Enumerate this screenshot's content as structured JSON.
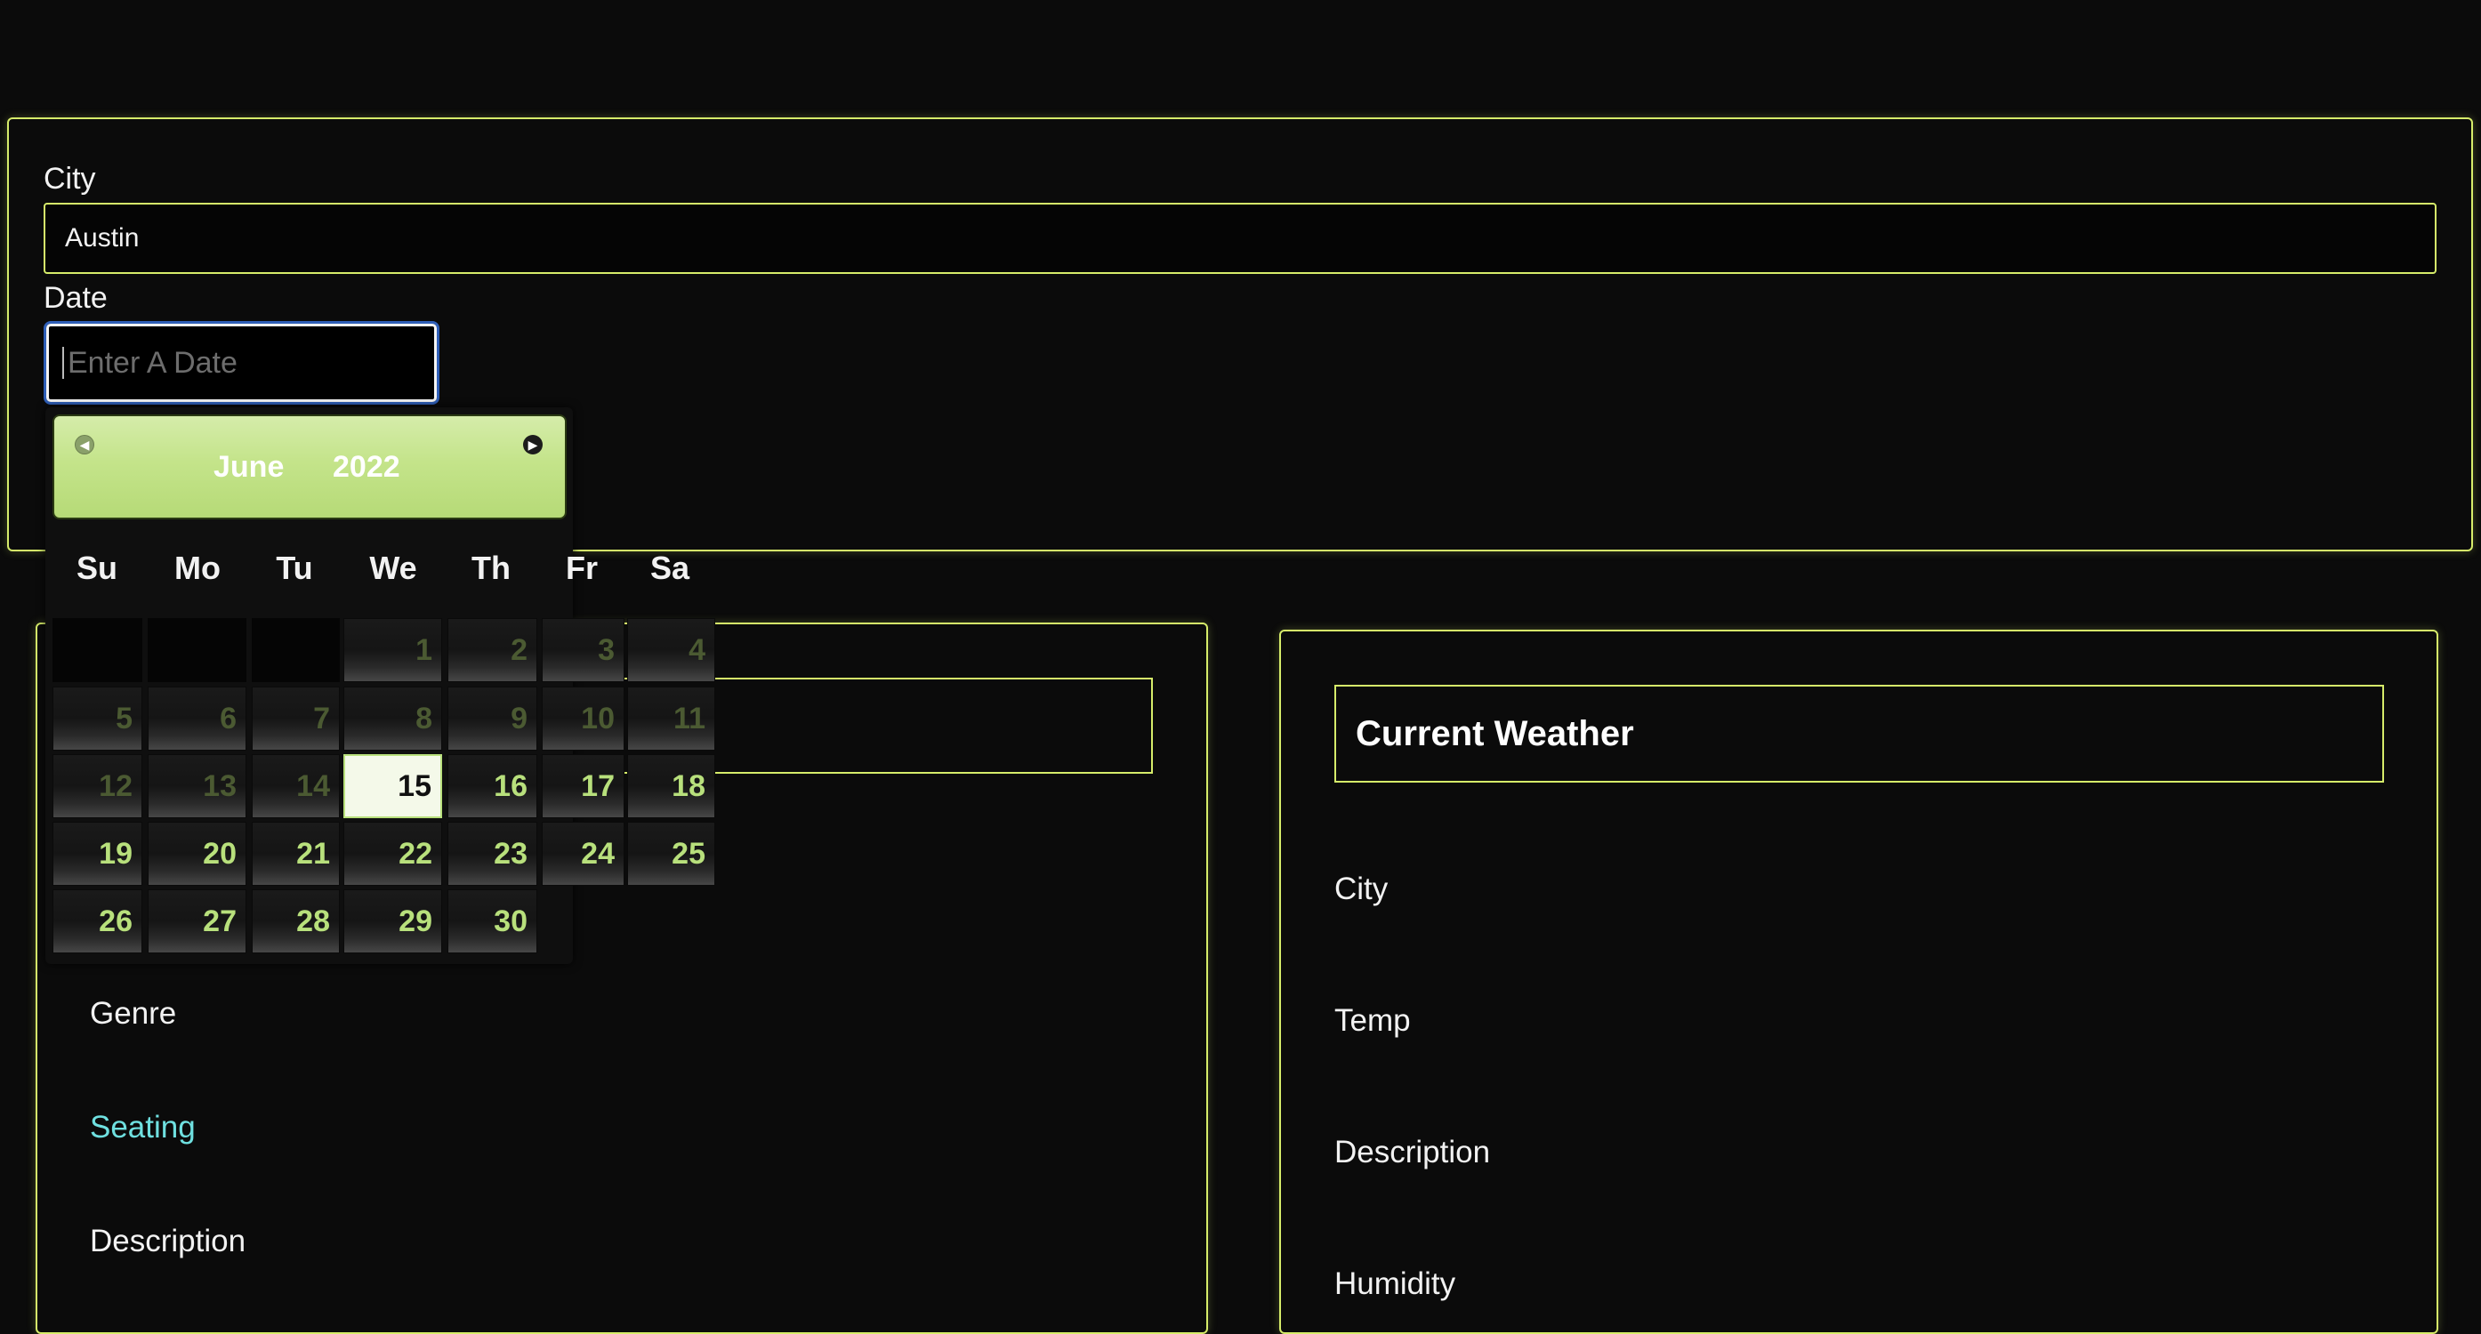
{
  "search": {
    "city_label": "City",
    "city_value": "Austin",
    "date_label": "Date",
    "date_placeholder": "Enter A Date"
  },
  "datepicker": {
    "month": "June",
    "year": "2022",
    "weekdays": [
      "Su",
      "Mo",
      "Tu",
      "We",
      "Th",
      "Fr",
      "Sa"
    ],
    "days": [
      "1",
      "2",
      "3",
      "4",
      "5",
      "6",
      "7",
      "8",
      "9",
      "10",
      "11",
      "12",
      "13",
      "14",
      "15",
      "16",
      "17",
      "18",
      "19",
      "20",
      "21",
      "22",
      "23",
      "24",
      "25",
      "26",
      "27",
      "28",
      "29",
      "30"
    ],
    "selected_day": "15",
    "prev_icon": "prev-arrow-icon",
    "next_icon": "next-arrow-icon"
  },
  "event_panel": {
    "fields": [
      "Genre",
      "Seating",
      "Description"
    ]
  },
  "weather": {
    "title": "Current Weather",
    "fields": [
      "City",
      "Temp",
      "Description",
      "Humidity"
    ]
  },
  "colors": {
    "accent": "#d6ec6a",
    "link": "#6fe0e0",
    "calendar_header": "#c4e48a"
  }
}
